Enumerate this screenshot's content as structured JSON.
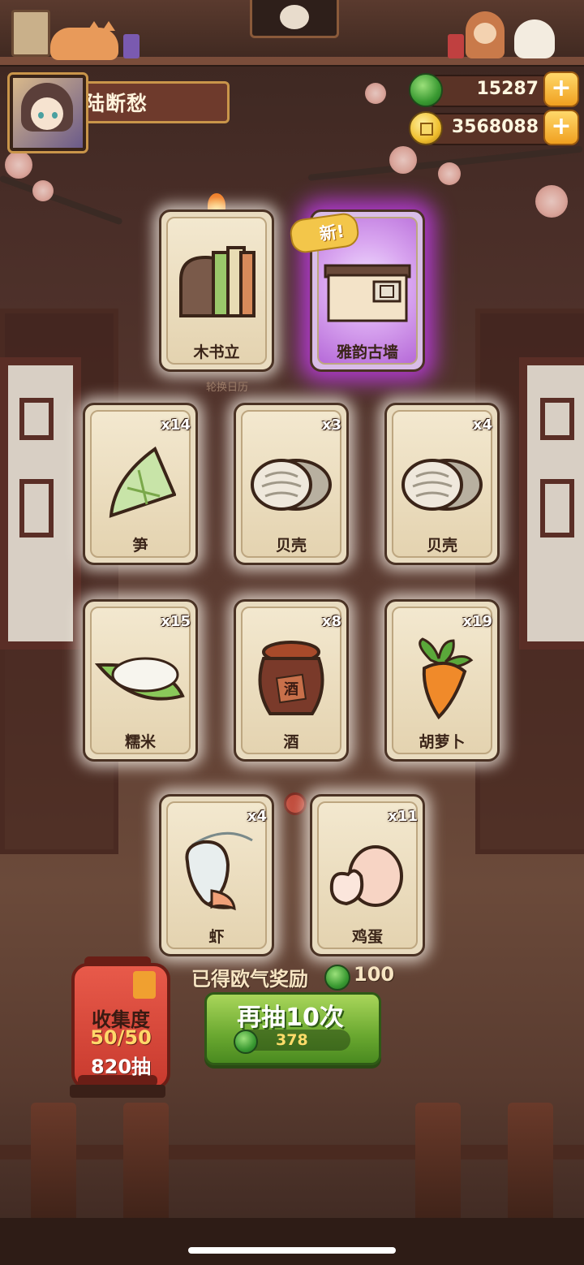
{
  "player": {
    "name": "陆断愁"
  },
  "currency": {
    "jade": {
      "value": "15287",
      "icon": "jade-icon",
      "color": "#3a9a32"
    },
    "coins": {
      "value": "3568088",
      "icon": "coin-icon",
      "color": "#f0c030"
    }
  },
  "featured_cards": [
    {
      "name": "木书立",
      "icon": "bookend-icon",
      "rarity": "normal"
    },
    {
      "name": "雅韵古墙",
      "icon": "ancient-wall-icon",
      "rarity": "purple",
      "badge": "新!"
    }
  ],
  "rotation_label": "轮换日历",
  "cards": [
    {
      "name": "笋",
      "count": "x14",
      "icon": "bamboo-shoot-icon"
    },
    {
      "name": "贝壳",
      "count": "x3",
      "icon": "shell-icon"
    },
    {
      "name": "贝壳",
      "count": "x4",
      "icon": "shell-icon"
    },
    {
      "name": "糯米",
      "count": "x15",
      "icon": "rice-icon"
    },
    {
      "name": "酒",
      "count": "x8",
      "icon": "wine-jar-icon",
      "jar_text": "酒"
    },
    {
      "name": "胡萝卜",
      "count": "x19",
      "icon": "carrot-icon"
    },
    {
      "name": "虾",
      "count": "x4",
      "icon": "shrimp-icon"
    },
    {
      "name": "鸡蛋",
      "count": "x11",
      "icon": "egg-icon"
    }
  ],
  "reward": {
    "label": "已得欧气奖励",
    "value": "100"
  },
  "draw_button": {
    "label": "再抽10次",
    "cost": "378"
  },
  "collection": {
    "title": "收集度",
    "progress": "50/50",
    "draws": "820抽"
  },
  "colors": {
    "accent_green": "#6aa830",
    "plus_orange": "#f0a020",
    "purple_glow": "#be3ce6"
  }
}
